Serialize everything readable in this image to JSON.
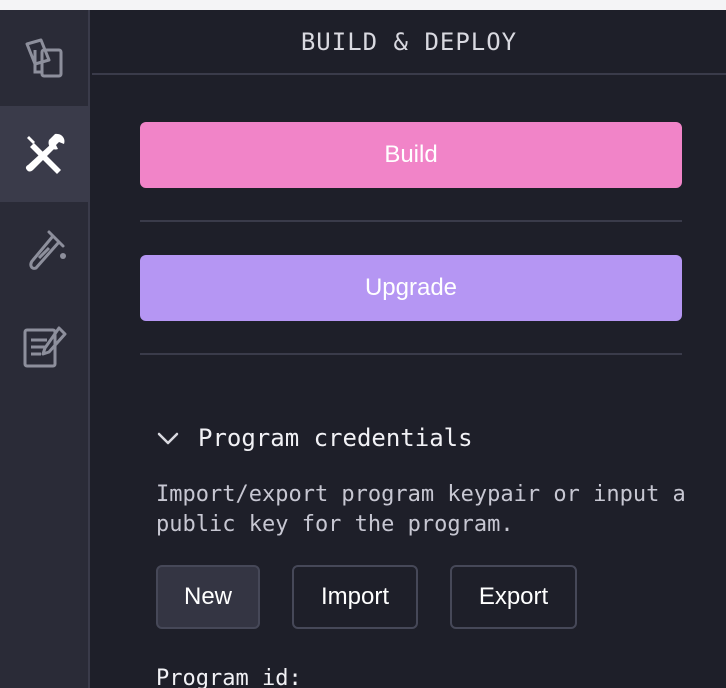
{
  "sidebar": {
    "items": [
      {
        "icon": "files-icon",
        "active": false
      },
      {
        "icon": "build-tools-icon",
        "active": true
      },
      {
        "icon": "test-tube-icon",
        "active": false
      },
      {
        "icon": "document-edit-icon",
        "active": false
      }
    ]
  },
  "panel": {
    "title": "BUILD & DEPLOY",
    "build_label": "Build",
    "upgrade_label": "Upgrade",
    "credentials": {
      "title": "Program credentials",
      "description": "Import/export program keypair or input a public key for the program.",
      "new_label": "New",
      "import_label": "Import",
      "export_label": "Export",
      "program_id_label": "Program id:"
    }
  },
  "colors": {
    "build": "#f184c8",
    "upgrade": "#b596f3",
    "background": "#1e1f29",
    "sidebar": "#2a2b37"
  }
}
